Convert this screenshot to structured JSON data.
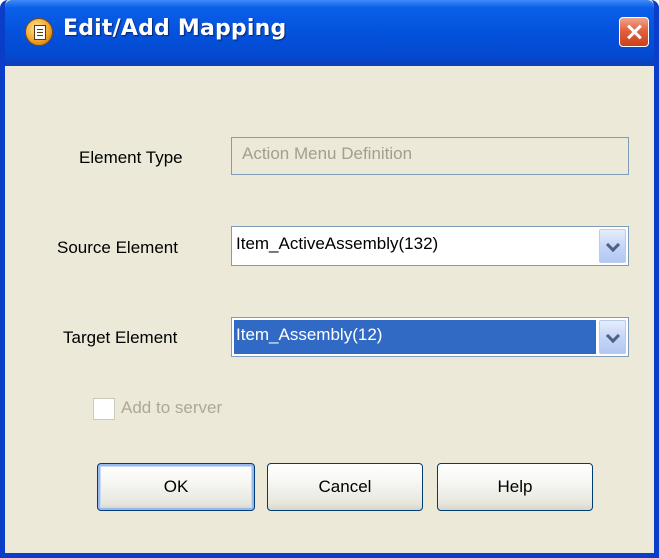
{
  "window": {
    "title": "Edit/Add Mapping",
    "title_icon": "app-icon",
    "close_icon": "close-icon"
  },
  "form": {
    "element_type": {
      "label": "Element Type",
      "value": "Action Menu Definition"
    },
    "source_element": {
      "label": "Source Element",
      "value": "Item_ActiveAssembly(132)"
    },
    "target_element": {
      "label": "Target Element",
      "value": "Item_Assembly(12)"
    },
    "add_to_server": {
      "label": "Add to server",
      "checked": false
    }
  },
  "buttons": {
    "ok": "OK",
    "cancel": "Cancel",
    "help": "Help"
  },
  "colors": {
    "titlebar": "#0452dc",
    "dialog_bg": "#ece9d8",
    "selection": "#316ac5"
  }
}
